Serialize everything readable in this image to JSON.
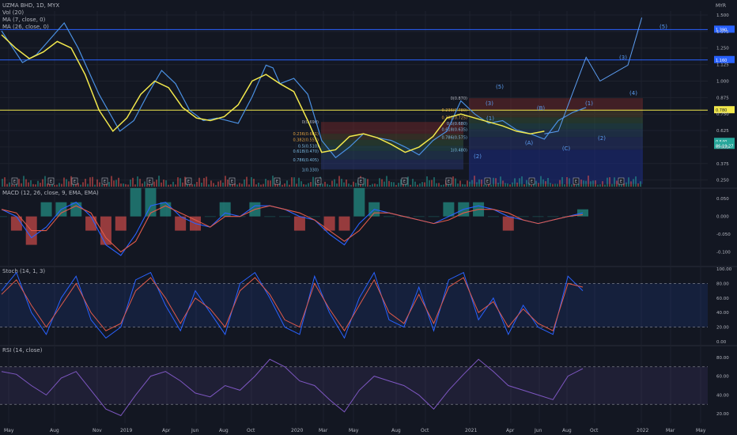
{
  "header": {
    "symbol_line": "UZMA BHD, 1D, MYX",
    "currency": "MYR",
    "indicators": [
      "Vol (20)",
      "MA (7, close, 0)",
      "MA (26, close, 0)"
    ]
  },
  "panels": {
    "macd_label": "MACD (12, 26, close, 9, EMA, EMA)",
    "stoch_label": "Stoch (14, 1, 3)",
    "rsi_label": "RSI (14, close)"
  },
  "colors": {
    "background": "#131722",
    "grid": "#1e222d",
    "price": "#4a90e2",
    "ma_yellow": "#f2e84c",
    "macd_line": "#2962ff",
    "signal_line": "#e05a4a",
    "hist_up": "#26a69a",
    "hist_down": "#ef5350",
    "stoch_k": "#2962ff",
    "stoch_d": "#e05a4a",
    "rsi": "#7e57c2",
    "hline": "#2962ff",
    "yellow_level": "#f2e84c"
  },
  "chart_data": [
    {
      "type": "line",
      "title": "UZMA BHD, 1D, MYX",
      "x_ticks": [
        "May",
        "Aug",
        "Nov",
        "2019",
        "Apr",
        "Jun",
        "Aug",
        "Oct",
        "2020",
        "Mar",
        "May",
        "Aug",
        "Oct",
        "2021",
        "Apr",
        "Jun",
        "Aug",
        "Oct",
        "2022",
        "Mar",
        "May"
      ],
      "y_ticks": [
        "1.500",
        "1.375",
        "1.250",
        "1.125",
        "1.000",
        "0.875",
        "0.750",
        "0.625",
        "0.500",
        "0.375",
        "0.250"
      ],
      "ylim": [
        0.2,
        1.53
      ],
      "series": [
        {
          "name": "Price",
          "x": [
            0,
            1,
            3,
            5,
            7,
            9,
            11,
            14,
            17,
            19,
            21,
            23,
            25,
            27,
            29,
            31,
            34,
            36,
            38,
            39,
            40,
            42,
            44,
            46,
            48,
            50,
            52,
            54,
            56,
            58,
            60,
            62,
            64,
            66,
            68,
            70,
            72,
            74,
            76,
            78,
            80,
            82,
            84
          ],
          "values": [
            1.38,
            1.3,
            1.14,
            1.2,
            1.32,
            1.44,
            1.25,
            0.9,
            0.62,
            0.7,
            0.9,
            1.08,
            0.98,
            0.78,
            0.7,
            0.72,
            0.68,
            0.88,
            1.12,
            1.1,
            0.98,
            1.02,
            0.9,
            0.55,
            0.42,
            0.5,
            0.6,
            0.57,
            0.55,
            0.5,
            0.44,
            0.55,
            0.62,
            0.85,
            0.75,
            0.68,
            0.7,
            0.63,
            0.6,
            0.56,
            0.7,
            0.76,
            0.8
          ]
        },
        {
          "name": "MA (26, close, 0)",
          "x": [
            0,
            2,
            4,
            6,
            8,
            10,
            12,
            14,
            16,
            18,
            20,
            22,
            24,
            26,
            28,
            30,
            32,
            34,
            36,
            38,
            40,
            42,
            44,
            46,
            48,
            50,
            52,
            54,
            56,
            58,
            60,
            62,
            64,
            66,
            68,
            70,
            72,
            74,
            76,
            78
          ],
          "values": [
            1.35,
            1.25,
            1.17,
            1.22,
            1.3,
            1.25,
            1.05,
            0.78,
            0.62,
            0.72,
            0.9,
            1.0,
            0.95,
            0.8,
            0.72,
            0.7,
            0.73,
            0.82,
            1.0,
            1.05,
            0.98,
            0.92,
            0.7,
            0.46,
            0.48,
            0.58,
            0.6,
            0.57,
            0.52,
            0.46,
            0.5,
            0.58,
            0.72,
            0.75,
            0.72,
            0.69,
            0.66,
            0.62,
            0.6,
            0.62
          ]
        },
        {
          "name": "Elliott projection",
          "x": [
            78,
            80,
            84,
            86,
            90,
            92
          ],
          "values": [
            0.6,
            0.62,
            1.18,
            1.0,
            1.12,
            1.48
          ]
        }
      ],
      "price_labels": [
        "1.390",
        "1.160",
        "0.780",
        "0.540",
        "86:19:27"
      ],
      "horizontal_lines": [
        1.39,
        1.16,
        0.78
      ],
      "annotations": {
        "fib_box_1": [
          "0(0.690)",
          "0.236(0.601)",
          "0.382(0.555)",
          "0.5(0.510)",
          "0.618(0.470)",
          "0.786(0.405)",
          "1(0.330)"
        ],
        "fib_box_2": [
          "0(0.870)",
          "0.236(0.780)",
          "0.382(0.725)",
          "0.5(0.680)",
          "0.618(0.635)",
          "0.786(0.575)",
          "1(0.480)"
        ],
        "elliott_wave_labels": [
          "(5)",
          "(3)",
          "(1)",
          "(B)",
          "(A)",
          "(C)",
          "(2)",
          "(1)",
          "(2)",
          "(3)",
          "(4)",
          "(5)"
        ],
        "event_markers": [
          "E",
          "E",
          "E",
          "E",
          "E",
          "E",
          "E",
          "E",
          "E",
          "E",
          "E",
          "E",
          "E",
          "E",
          "E",
          "E"
        ]
      }
    },
    {
      "type": "bar",
      "title": "MACD (12, 26, close, 9, EMA, EMA)",
      "y_ticks": [
        "0.050",
        "0.000",
        "-0.050",
        "-0.100"
      ],
      "ylim": [
        -0.13,
        0.075
      ],
      "series": [
        {
          "name": "MACD",
          "values": [
            0.02,
            0.0,
            -0.06,
            -0.03,
            0.02,
            0.04,
            0.0,
            -0.08,
            -0.11,
            -0.05,
            0.03,
            0.04,
            0.0,
            -0.02,
            -0.03,
            0.01,
            0.0,
            0.03,
            0.03,
            0.02,
            0.0,
            -0.01,
            -0.05,
            -0.08,
            -0.02,
            0.02,
            0.01,
            0.0,
            -0.01,
            -0.02,
            0.0,
            0.02,
            0.03,
            0.02,
            0.0,
            -0.01,
            -0.02,
            -0.01,
            0.0,
            0.01
          ]
        },
        {
          "name": "Signal",
          "values": [
            0.02,
            0.01,
            -0.04,
            -0.04,
            0.01,
            0.03,
            0.01,
            -0.06,
            -0.1,
            -0.07,
            0.01,
            0.03,
            0.01,
            -0.01,
            -0.03,
            0.0,
            0.0,
            0.02,
            0.03,
            0.02,
            0.01,
            -0.01,
            -0.04,
            -0.07,
            -0.04,
            0.01,
            0.01,
            0.0,
            -0.01,
            -0.02,
            -0.01,
            0.01,
            0.02,
            0.02,
            0.01,
            -0.01,
            -0.02,
            -0.01,
            0.0,
            0.005
          ]
        }
      ]
    },
    {
      "type": "line",
      "title": "Stoch (14, 1, 3)",
      "y_ticks": [
        "100.00",
        "80.00",
        "60.00",
        "40.00",
        "20.00",
        "0.00"
      ],
      "ylim": [
        0,
        100
      ],
      "bands": [
        20,
        80
      ],
      "series": [
        {
          "name": "%K",
          "values": [
            70,
            95,
            40,
            10,
            60,
            90,
            30,
            5,
            20,
            85,
            95,
            50,
            15,
            70,
            40,
            10,
            80,
            95,
            60,
            20,
            10,
            90,
            40,
            5,
            60,
            95,
            30,
            20,
            75,
            15,
            85,
            95,
            30,
            60,
            10,
            50,
            20,
            10,
            90,
            70
          ]
        },
        {
          "name": "%D",
          "values": [
            65,
            85,
            50,
            20,
            50,
            80,
            40,
            15,
            25,
            70,
            88,
            60,
            25,
            60,
            45,
            20,
            70,
            88,
            65,
            30,
            20,
            80,
            45,
            15,
            50,
            85,
            40,
            25,
            65,
            25,
            75,
            88,
            40,
            55,
            20,
            45,
            25,
            15,
            80,
            75
          ]
        }
      ]
    },
    {
      "type": "line",
      "title": "RSI (14, close)",
      "y_ticks": [
        "80.00",
        "60.00",
        "40.00",
        "20.00"
      ],
      "ylim": [
        10,
        90
      ],
      "bands": [
        30,
        70
      ],
      "series": [
        {
          "name": "RSI",
          "values": [
            65,
            62,
            50,
            40,
            58,
            65,
            45,
            25,
            18,
            40,
            60,
            65,
            55,
            42,
            38,
            50,
            45,
            60,
            78,
            70,
            55,
            50,
            35,
            22,
            45,
            60,
            55,
            50,
            40,
            25,
            45,
            62,
            78,
            65,
            50,
            45,
            40,
            35,
            60,
            68
          ]
        }
      ]
    }
  ]
}
